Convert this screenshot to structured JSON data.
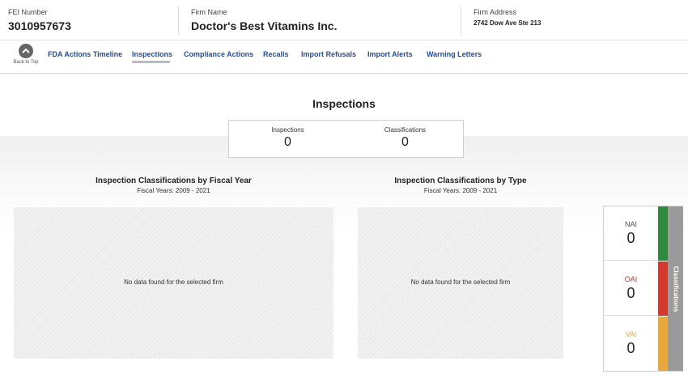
{
  "header": {
    "fei_label": "FEI Number",
    "fei_value": "3010957673",
    "firm_name_label": "Firm Name",
    "firm_name_value": "Doctor's Best Vitamins Inc.",
    "firm_address_label": "Firm Address",
    "firm_address_value": "2742 Dow Ave Ste 213"
  },
  "nav": {
    "back_to_top": "Back to Top",
    "items": [
      {
        "label": "FDA Actions Timeline"
      },
      {
        "label": "Inspections",
        "active": true
      },
      {
        "label": "Compliance Actions"
      },
      {
        "label": "Recalls"
      },
      {
        "label": "Import Refusals"
      },
      {
        "label": "Import Alerts"
      },
      {
        "label": "Warning Letters"
      }
    ]
  },
  "section": {
    "title": "Inspections",
    "summary": {
      "inspections_label": "Inspections",
      "inspections_value": "0",
      "classifications_label": "Classifications",
      "classifications_value": "0"
    }
  },
  "charts": {
    "by_year": {
      "title": "Inspection Classifications by Fiscal Year",
      "subtitle": "Fiscal Years: 2009 - 2021",
      "empty_message": "No data found for the selected firm"
    },
    "by_type": {
      "title": "Inspection Classifications by Type",
      "subtitle": "Fiscal Years: 2009 - 2021",
      "empty_message": "No data found for the selected firm"
    }
  },
  "classifications": {
    "tab_label": "Classifications",
    "items": [
      {
        "name": "NAI",
        "value": "0",
        "color": "#2e8b3e",
        "text_color": "#555555"
      },
      {
        "name": "OAI",
        "value": "0",
        "color": "#d23a2e",
        "text_color": "#c0392b"
      },
      {
        "name": "VAI",
        "value": "0",
        "color": "#e8a93a",
        "text_color": "#e8a93a"
      }
    ]
  },
  "icons": {
    "back_to_top": "chevron-up-icon"
  }
}
